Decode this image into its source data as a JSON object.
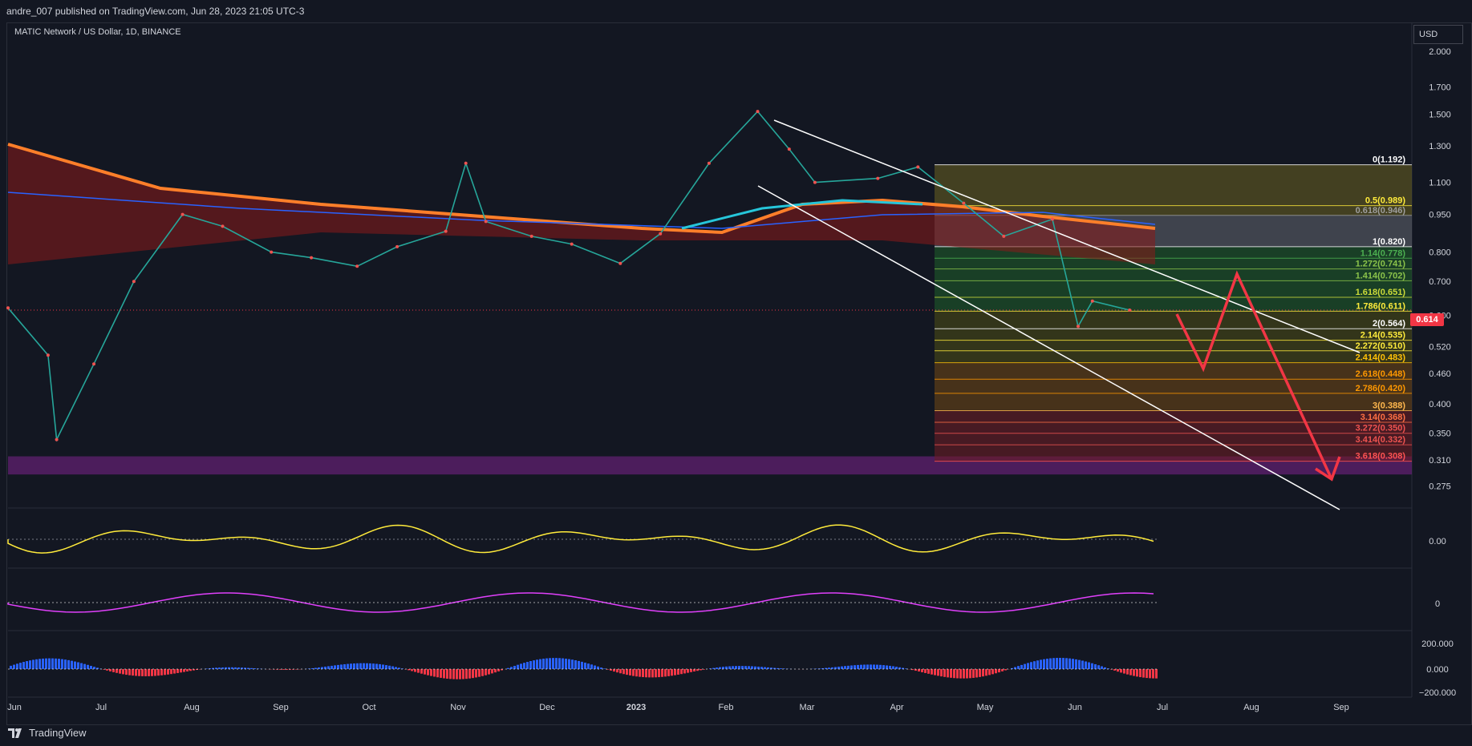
{
  "header": {
    "published_text": "andre_007 published on TradingView.com, Jun 28, 2023 21:05 UTC-3"
  },
  "symbol_info": {
    "title": "MATIC Network / US Dollar, 1D, BINANCE"
  },
  "price_scale": {
    "currency": "USD",
    "ticks": [
      "2.000",
      "1.700",
      "1.500",
      "1.300",
      "1.100",
      "0.950",
      "0.800",
      "0.700",
      "0.600",
      "0.520",
      "0.460",
      "0.400",
      "0.350",
      "0.310",
      "0.275"
    ],
    "current_price": "0.614"
  },
  "time_axis": {
    "labels": [
      "Jun",
      "Jul",
      "Aug",
      "Sep",
      "Oct",
      "Nov",
      "Dec",
      "2023",
      "Feb",
      "Mar",
      "Apr",
      "May",
      "Jun",
      "Jul",
      "Aug",
      "Sep"
    ]
  },
  "indicators": {
    "osc1_label": "0.00",
    "osc2_label": "0",
    "osc3_labels": [
      "200.000",
      "0.000",
      "−200.000"
    ]
  },
  "fib_levels": [
    {
      "label": "0(1.192)",
      "price": 1.192,
      "color": "#ffffff"
    },
    {
      "label": "0.5(0.989)",
      "price": 0.989,
      "color": "#ffeb3b"
    },
    {
      "label": "0.618(0.946)",
      "price": 0.946,
      "color": "#9e9e9e"
    },
    {
      "label": "1(0.820)",
      "price": 0.82,
      "color": "#ffffff"
    },
    {
      "label": "1.14(0.778)",
      "price": 0.778,
      "color": "#4caf50"
    },
    {
      "label": "1.272(0.741)",
      "price": 0.741,
      "color": "#8bc34a"
    },
    {
      "label": "1.414(0.702)",
      "price": 0.702,
      "color": "#8bc34a"
    },
    {
      "label": "1.618(0.651)",
      "price": 0.651,
      "color": "#cddc39"
    },
    {
      "label": "1.786(0.611)",
      "price": 0.611,
      "color": "#ffeb3b"
    },
    {
      "label": "2(0.564)",
      "price": 0.564,
      "color": "#ffffff"
    },
    {
      "label": "2.14(0.535)",
      "price": 0.535,
      "color": "#ffeb3b"
    },
    {
      "label": "2.272(0.510)",
      "price": 0.51,
      "color": "#ffeb3b"
    },
    {
      "label": "2.414(0.483)",
      "price": 0.483,
      "color": "#ffc107"
    },
    {
      "label": "2.618(0.448)",
      "price": 0.448,
      "color": "#ff9800"
    },
    {
      "label": "2.786(0.420)",
      "price": 0.42,
      "color": "#ff9800"
    },
    {
      "label": "3(0.388)",
      "price": 0.388,
      "color": "#ffb74d"
    },
    {
      "label": "3.14(0.368)",
      "price": 0.368,
      "color": "#ff7043"
    },
    {
      "label": "3.272(0.350)",
      "price": 0.35,
      "color": "#ef5350"
    },
    {
      "label": "3.414(0.332)",
      "price": 0.332,
      "color": "#ef5350"
    },
    {
      "label": "3.618(0.308)",
      "price": 0.308,
      "color": "#ff5252"
    }
  ],
  "chart_data": {
    "type": "line",
    "title": "MATIC Network / US Dollar, 1D, BINANCE",
    "xlabel": "",
    "ylabel": "USD",
    "log_scale": true,
    "ylim": [
      0.26,
      2.2
    ],
    "x": [
      "2022-06-01",
      "2022-06-15",
      "2022-06-18",
      "2022-07-01",
      "2022-07-15",
      "2022-08-01",
      "2022-08-15",
      "2022-09-01",
      "2022-09-15",
      "2022-10-01",
      "2022-10-15",
      "2022-11-01",
      "2022-11-08",
      "2022-11-15",
      "2022-12-01",
      "2022-12-15",
      "2023-01-01",
      "2023-01-15",
      "2023-02-01",
      "2023-02-18",
      "2023-03-01",
      "2023-03-10",
      "2023-04-01",
      "2023-04-15",
      "2023-05-01",
      "2023-05-15",
      "2023-06-01",
      "2023-06-10",
      "2023-06-15",
      "2023-06-28"
    ],
    "series": [
      {
        "values": [
          0.62,
          0.5,
          0.34,
          0.48,
          0.7,
          0.95,
          0.9,
          0.8,
          0.78,
          0.75,
          0.82,
          0.88,
          1.2,
          0.92,
          0.86,
          0.83,
          0.76,
          0.87,
          1.2,
          1.52,
          1.28,
          1.1,
          1.12,
          1.18,
          1.0,
          0.86,
          0.93,
          0.57,
          0.64,
          0.614
        ]
      }
    ],
    "grid": false
  }
}
